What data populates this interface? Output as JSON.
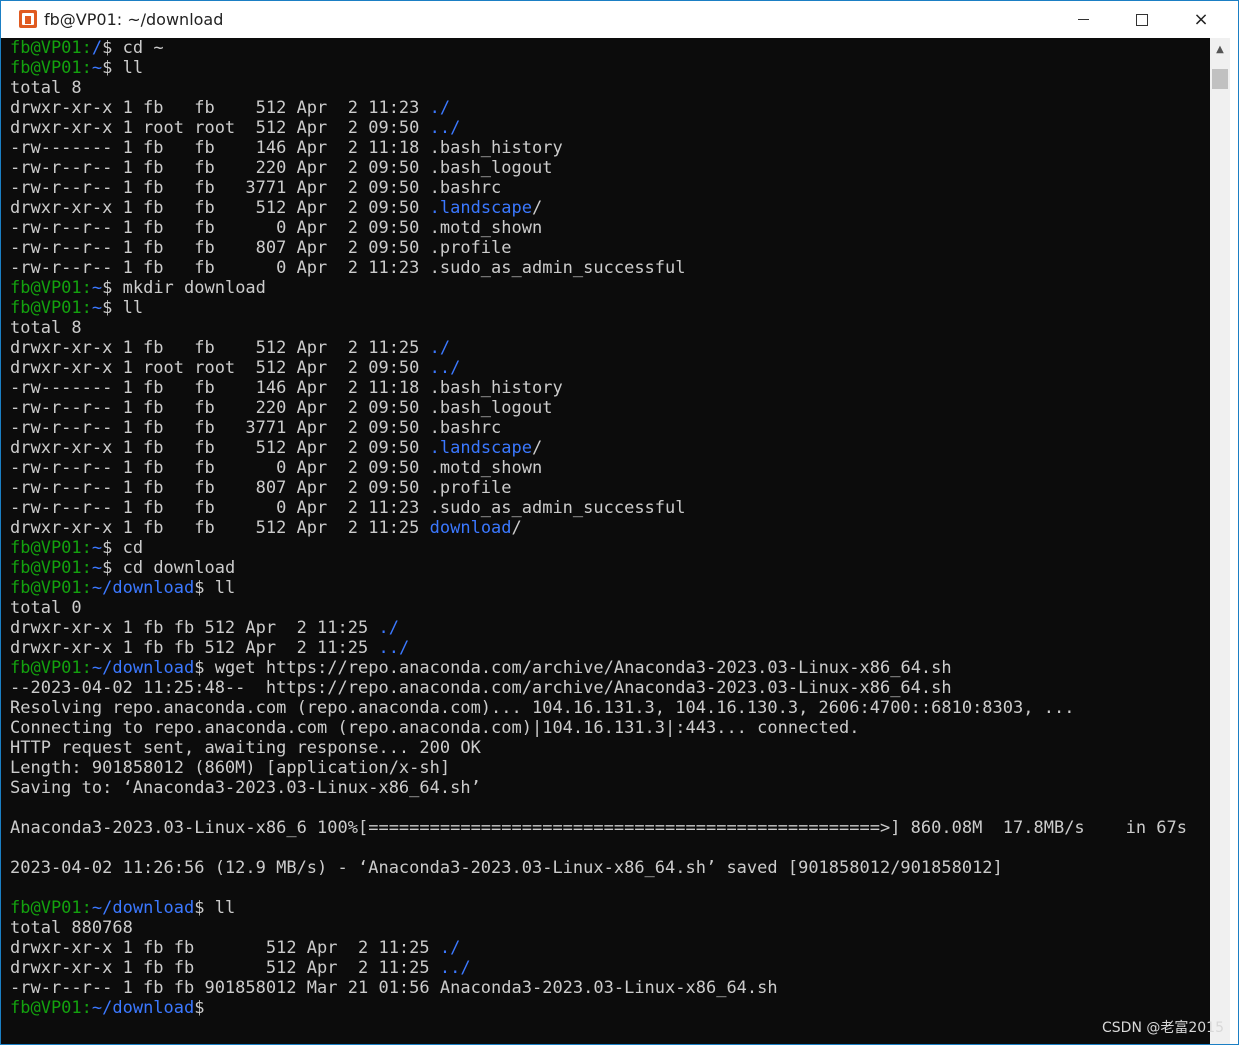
{
  "window": {
    "title": "fb@VP01: ~/download",
    "icon": "ubuntu-terminal-icon",
    "controls": {
      "minimize": "minimize-icon",
      "maximize": "maximize-icon",
      "close": "×"
    }
  },
  "colors": {
    "background": "#0c0c0c",
    "text": "#cccccc",
    "prompt": "#13a10e",
    "directory": "#3b78ff"
  },
  "terminal": {
    "lines": [
      [
        {
          "t": "fb@VP01:",
          "c": "green"
        },
        {
          "t": "/",
          "c": "blue"
        },
        {
          "t": "$ cd ~",
          "c": "default"
        }
      ],
      [
        {
          "t": "fb@VP01:",
          "c": "green"
        },
        {
          "t": "~",
          "c": "blue"
        },
        {
          "t": "$ ll",
          "c": "default"
        }
      ],
      [
        {
          "t": "total 8",
          "c": "default"
        }
      ],
      [
        {
          "t": "drwxr-xr-x 1 fb   fb    512 Apr  2 11:23 ",
          "c": "default"
        },
        {
          "t": "./",
          "c": "blue"
        }
      ],
      [
        {
          "t": "drwxr-xr-x 1 root root  512 Apr  2 09:50 ",
          "c": "default"
        },
        {
          "t": "../",
          "c": "blue"
        }
      ],
      [
        {
          "t": "-rw------- 1 fb   fb    146 Apr  2 11:18 .bash_history",
          "c": "default"
        }
      ],
      [
        {
          "t": "-rw-r--r-- 1 fb   fb    220 Apr  2 09:50 .bash_logout",
          "c": "default"
        }
      ],
      [
        {
          "t": "-rw-r--r-- 1 fb   fb   3771 Apr  2 09:50 .bashrc",
          "c": "default"
        }
      ],
      [
        {
          "t": "drwxr-xr-x 1 fb   fb    512 Apr  2 09:50 ",
          "c": "default"
        },
        {
          "t": ".landscape",
          "c": "blue"
        },
        {
          "t": "/",
          "c": "default"
        }
      ],
      [
        {
          "t": "-rw-r--r-- 1 fb   fb      0 Apr  2 09:50 .motd_shown",
          "c": "default"
        }
      ],
      [
        {
          "t": "-rw-r--r-- 1 fb   fb    807 Apr  2 09:50 .profile",
          "c": "default"
        }
      ],
      [
        {
          "t": "-rw-r--r-- 1 fb   fb      0 Apr  2 11:23 .sudo_as_admin_successful",
          "c": "default"
        }
      ],
      [
        {
          "t": "fb@VP01:",
          "c": "green"
        },
        {
          "t": "~",
          "c": "blue"
        },
        {
          "t": "$ mkdir download",
          "c": "default"
        }
      ],
      [
        {
          "t": "fb@VP01:",
          "c": "green"
        },
        {
          "t": "~",
          "c": "blue"
        },
        {
          "t": "$ ll",
          "c": "default"
        }
      ],
      [
        {
          "t": "total 8",
          "c": "default"
        }
      ],
      [
        {
          "t": "drwxr-xr-x 1 fb   fb    512 Apr  2 11:25 ",
          "c": "default"
        },
        {
          "t": "./",
          "c": "blue"
        }
      ],
      [
        {
          "t": "drwxr-xr-x 1 root root  512 Apr  2 09:50 ",
          "c": "default"
        },
        {
          "t": "../",
          "c": "blue"
        }
      ],
      [
        {
          "t": "-rw------- 1 fb   fb    146 Apr  2 11:18 .bash_history",
          "c": "default"
        }
      ],
      [
        {
          "t": "-rw-r--r-- 1 fb   fb    220 Apr  2 09:50 .bash_logout",
          "c": "default"
        }
      ],
      [
        {
          "t": "-rw-r--r-- 1 fb   fb   3771 Apr  2 09:50 .bashrc",
          "c": "default"
        }
      ],
      [
        {
          "t": "drwxr-xr-x 1 fb   fb    512 Apr  2 09:50 ",
          "c": "default"
        },
        {
          "t": ".landscape",
          "c": "blue"
        },
        {
          "t": "/",
          "c": "default"
        }
      ],
      [
        {
          "t": "-rw-r--r-- 1 fb   fb      0 Apr  2 09:50 .motd_shown",
          "c": "default"
        }
      ],
      [
        {
          "t": "-rw-r--r-- 1 fb   fb    807 Apr  2 09:50 .profile",
          "c": "default"
        }
      ],
      [
        {
          "t": "-rw-r--r-- 1 fb   fb      0 Apr  2 11:23 .sudo_as_admin_successful",
          "c": "default"
        }
      ],
      [
        {
          "t": "drwxr-xr-x 1 fb   fb    512 Apr  2 11:25 ",
          "c": "default"
        },
        {
          "t": "download",
          "c": "blue"
        },
        {
          "t": "/",
          "c": "default"
        }
      ],
      [
        {
          "t": "fb@VP01:",
          "c": "green"
        },
        {
          "t": "~",
          "c": "blue"
        },
        {
          "t": "$ cd",
          "c": "default"
        }
      ],
      [
        {
          "t": "fb@VP01:",
          "c": "green"
        },
        {
          "t": "~",
          "c": "blue"
        },
        {
          "t": "$ cd download",
          "c": "default"
        }
      ],
      [
        {
          "t": "fb@VP01:",
          "c": "green"
        },
        {
          "t": "~/download",
          "c": "blue"
        },
        {
          "t": "$ ll",
          "c": "default"
        }
      ],
      [
        {
          "t": "total 0",
          "c": "default"
        }
      ],
      [
        {
          "t": "drwxr-xr-x 1 fb fb 512 Apr  2 11:25 ",
          "c": "default"
        },
        {
          "t": "./",
          "c": "blue"
        }
      ],
      [
        {
          "t": "drwxr-xr-x 1 fb fb 512 Apr  2 11:25 ",
          "c": "default"
        },
        {
          "t": "../",
          "c": "blue"
        }
      ],
      [
        {
          "t": "fb@VP01:",
          "c": "green"
        },
        {
          "t": "~/download",
          "c": "blue"
        },
        {
          "t": "$ wget https://repo.anaconda.com/archive/Anaconda3-2023.03-Linux-x86_64.sh",
          "c": "default"
        }
      ],
      [
        {
          "t": "--2023-04-02 11:25:48--  https://repo.anaconda.com/archive/Anaconda3-2023.03-Linux-x86_64.sh",
          "c": "default"
        }
      ],
      [
        {
          "t": "Resolving repo.anaconda.com (repo.anaconda.com)... 104.16.131.3, 104.16.130.3, 2606:4700::6810:8303, ...",
          "c": "default"
        }
      ],
      [
        {
          "t": "Connecting to repo.anaconda.com (repo.anaconda.com)|104.16.131.3|:443... connected.",
          "c": "default"
        }
      ],
      [
        {
          "t": "HTTP request sent, awaiting response... 200 OK",
          "c": "default"
        }
      ],
      [
        {
          "t": "Length: 901858012 (860M) [application/x-sh]",
          "c": "default"
        }
      ],
      [
        {
          "t": "Saving to: ‘Anaconda3-2023.03-Linux-x86_64.sh’",
          "c": "default"
        }
      ],
      [
        {
          "t": "",
          "c": "default"
        }
      ],
      [
        {
          "t": "Anaconda3-2023.03-Linux-x86_6 100%[==================================================>] 860.08M  17.8MB/s    in 67s",
          "c": "default"
        }
      ],
      [
        {
          "t": "",
          "c": "default"
        }
      ],
      [
        {
          "t": "2023-04-02 11:26:56 (12.9 MB/s) - ‘Anaconda3-2023.03-Linux-x86_64.sh’ saved [901858012/901858012]",
          "c": "default"
        }
      ],
      [
        {
          "t": "",
          "c": "default"
        }
      ],
      [
        {
          "t": "fb@VP01:",
          "c": "green"
        },
        {
          "t": "~/download",
          "c": "blue"
        },
        {
          "t": "$ ll",
          "c": "default"
        }
      ],
      [
        {
          "t": "total 880768",
          "c": "default"
        }
      ],
      [
        {
          "t": "drwxr-xr-x 1 fb fb       512 Apr  2 11:25 ",
          "c": "default"
        },
        {
          "t": "./",
          "c": "blue"
        }
      ],
      [
        {
          "t": "drwxr-xr-x 1 fb fb       512 Apr  2 11:25 ",
          "c": "default"
        },
        {
          "t": "../",
          "c": "blue"
        }
      ],
      [
        {
          "t": "-rw-r--r-- 1 fb fb 901858012 Mar 21 01:56 Anaconda3-2023.03-Linux-x86_64.sh",
          "c": "default"
        }
      ],
      [
        {
          "t": "fb@VP01:",
          "c": "green"
        },
        {
          "t": "~/download",
          "c": "blue"
        },
        {
          "t": "$",
          "c": "default"
        }
      ]
    ]
  },
  "scrollbar": {
    "up_arrow": "▲"
  },
  "watermark": "CSDN @老富2015"
}
